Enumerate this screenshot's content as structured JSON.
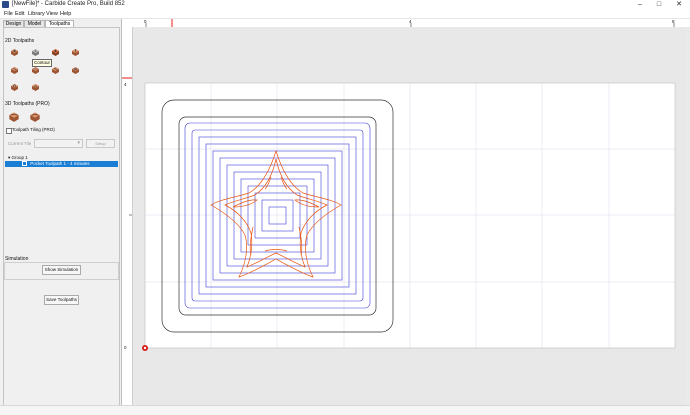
{
  "window": {
    "title": "[NewFile]* - Carbide Create Pro, Build 852",
    "controls": [
      "–",
      "□",
      "✕"
    ]
  },
  "menu": [
    "File",
    "Edit",
    "Library",
    "View",
    "Help"
  ],
  "tabs": [
    "Design",
    "Model",
    "Toolpaths"
  ],
  "active_tab": "Toolpaths",
  "toolpaths_2d": {
    "label": "2D Toolpaths",
    "tools": [
      "contour",
      "pocket",
      "drill",
      "vcarve",
      "advanced-vcarve",
      "texture",
      "engrave",
      "chamfer",
      "rapid-adaptive",
      "thread-mill"
    ],
    "tooltip": "Contour"
  },
  "toolpaths_3d": {
    "label": "3D Toolpaths (PRO)",
    "tools": [
      "3d-rough",
      "3d-finish"
    ]
  },
  "tiling": {
    "checkbox_label": "Toolpath Tiling (PRO)",
    "checked": false,
    "current_tile_label": "Current Tile",
    "setup_label": "Setup"
  },
  "tree": {
    "group": "Group 1",
    "item": "Pocket Toolpath 1 - 4 minutes"
  },
  "simulation": {
    "label": "Simulation",
    "show_button": "Show Simulation",
    "save_button": "Save Toolpaths"
  },
  "ruler": {
    "top": [
      "0",
      "4",
      "8"
    ],
    "left": [
      "4",
      "0"
    ]
  },
  "colors": {
    "accent": "#1a7fd4",
    "toolpath_blue": "#3f3fd8",
    "shape_orange": "#e8540f",
    "outline_dark": "#333333",
    "origin_red": "#d61b1b"
  }
}
